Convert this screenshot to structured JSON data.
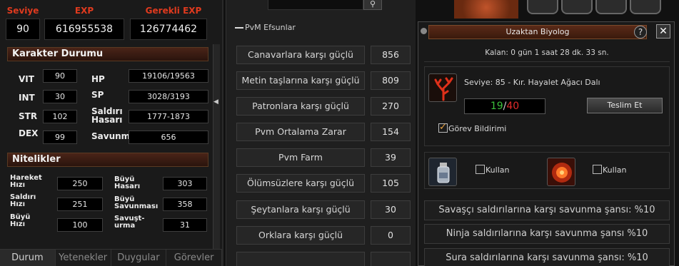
{
  "character": {
    "level_label": "Seviye",
    "level": "90",
    "exp_label": "EXP",
    "exp": "616955538",
    "req_exp_label": "Gerekli EXP",
    "req_exp": "126774462",
    "status_title": "Karakter Durumu",
    "vit_label": "VIT",
    "vit": "90",
    "int_label": "INT",
    "int": "30",
    "str_label": "STR",
    "str": "102",
    "dex_label": "DEX",
    "dex": "99",
    "hp_label": "HP",
    "hp": "19106/19563",
    "sp_label": "SP",
    "sp": "3028/3193",
    "attack_label_1": "Saldırı",
    "attack_label_2": "Hasarı",
    "attack": "1777-1873",
    "defense_label": "Savunm",
    "defense": "656",
    "traits_title": "Nitelikler",
    "move_speed_label_1": "Hareket",
    "move_speed_label_2": "Hızı",
    "move_speed": "250",
    "attack_speed_label_1": "Saldırı",
    "attack_speed_label_2": "Hızı",
    "attack_speed": "251",
    "magic_speed_label_1": "Büyü",
    "magic_speed_label_2": "Hızı",
    "magic_speed": "100",
    "magic_attack_label_1": "Büyü",
    "magic_attack_label_2": "Hasarı",
    "magic_attack": "303",
    "magic_defense_label_1": "Büyü",
    "magic_defense_label_2": "Savunması",
    "magic_defense": "358",
    "evasion_label_1": "Savuşt-",
    "evasion_label_2": "urma",
    "evasion": "31",
    "tabs": [
      "Durum",
      "Yetenekler",
      "Duygular",
      "Görevler"
    ]
  },
  "pvm": {
    "header": "PvM Efsunlar",
    "search_icon": "magnifier-icon",
    "rows": [
      {
        "label": "Canavarlara karşı güçlü",
        "value": "856"
      },
      {
        "label": "Metin taşlarına karşı güçlü",
        "value": "809"
      },
      {
        "label": "Patronlara karşı güçlü",
        "value": "270"
      },
      {
        "label": "Pvm Ortalama Zarar",
        "value": "154"
      },
      {
        "label": "Pvm Farm",
        "value": "39"
      },
      {
        "label": "Ölümsüzlere karşı güçlü",
        "value": "105"
      },
      {
        "label": "Şeytanlara karşı güçlü",
        "value": "30"
      },
      {
        "label": "Orklara karşı güçlü",
        "value": "0"
      },
      {
        "label": "",
        "value": ""
      }
    ]
  },
  "biolog": {
    "title": "Uzaktan Biyolog",
    "help": "?",
    "close": "✕",
    "remaining": "Kalan: 0 gün 1 saat 28 dk. 33 sn.",
    "item": "Seviye: 85 - Kır. Hayalet Ağacı Dalı",
    "count_have": "19",
    "count_sep": "/",
    "count_need": "40",
    "deliver": "Teslim Et",
    "notify": "Görev Bildirimi",
    "use_1": "Kullan",
    "use_2": "Kullan",
    "defenses": [
      "Savaşçı saldırılarına karşı savunma şansı: %10",
      "Ninja saldırılarına karşı savunma şansı %10",
      "Sura saldırılarına karşı savunma şansı: %10"
    ]
  },
  "colors": {
    "accent_red": "#e03a1e",
    "count_ok": "#3bc03b",
    "count_need": "#e02a2a"
  }
}
